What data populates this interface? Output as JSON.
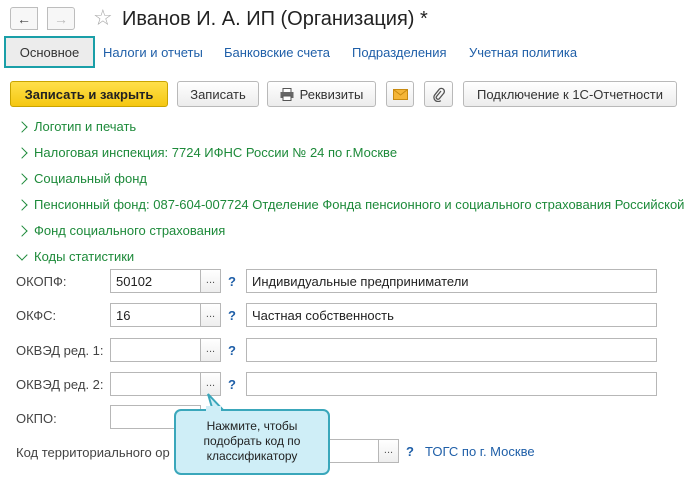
{
  "window": {
    "title": "Иванов И. А. ИП (Организация) *",
    "back_icon": "←",
    "forward_icon": "→",
    "star_icon": "☆"
  },
  "tabs": [
    {
      "label": "Основное",
      "active": true
    },
    {
      "label": "Налоги и отчеты"
    },
    {
      "label": "Банковские счета"
    },
    {
      "label": "Подразделения"
    },
    {
      "label": "Учетная политика"
    }
  ],
  "toolbar": {
    "save_close": "Записать и закрыть",
    "save": "Записать",
    "requisites": "Реквизиты",
    "connect": "Подключение к 1С-Отчетности"
  },
  "groups": [
    {
      "label": "Логотип и печать",
      "expanded": false
    },
    {
      "label": "Налоговая инспекция: 7724 ИФНС России № 24 по г.Москве",
      "expanded": false
    },
    {
      "label": "Социальный фонд",
      "expanded": false
    },
    {
      "label": "Пенсионный фонд: 087-604-007724 Отделение Фонда пенсионного и социального страхования Российской",
      "expanded": false
    },
    {
      "label": "Фонд социального страхования",
      "expanded": false
    },
    {
      "label": "Коды статистики",
      "expanded": true
    }
  ],
  "stats": {
    "okopf": {
      "label": "ОКОПФ:",
      "code": "50102",
      "description": "Индивидуальные предприниматели"
    },
    "okfs": {
      "label": "ОКФС:",
      "code": "16",
      "description": "Частная собственность"
    },
    "okved1": {
      "label": "ОКВЭД ред. 1:",
      "code": "",
      "description": ""
    },
    "okved2": {
      "label": "ОКВЭД ред. 2:",
      "code": "",
      "description": ""
    },
    "okpo": {
      "label": "ОКПО:",
      "code": ""
    },
    "territorial": {
      "label": "Код территориального ор",
      "code": "",
      "link": "ТОГС по г. Москве"
    }
  },
  "pick_label": "...",
  "help_label": "?",
  "tooltip": {
    "text_line1": "Нажмите, чтобы",
    "text_line2": "подобрать код по",
    "text_line3": "классификатору"
  },
  "colors": {
    "accent": "#1a9fa8",
    "link": "#1f5fa8",
    "group": "#1d8a3a",
    "primary": "#f5c712",
    "tooltip_bg": "#cfeef7"
  }
}
